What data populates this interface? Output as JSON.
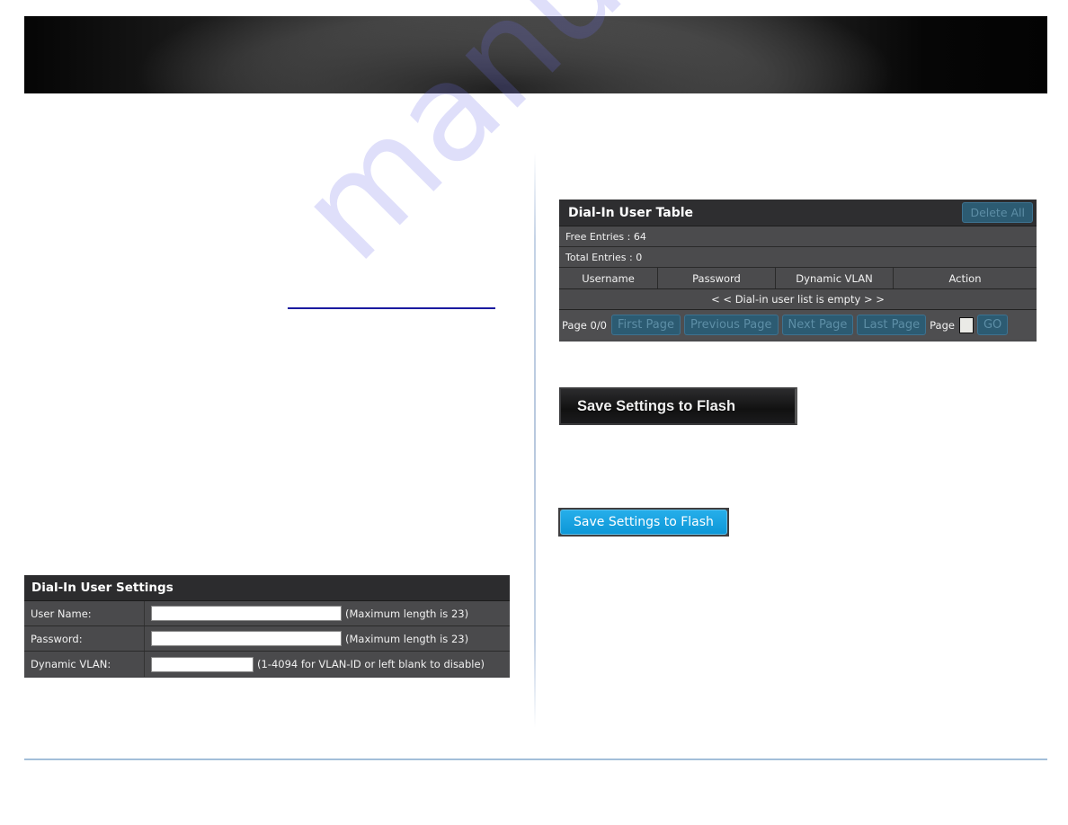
{
  "watermark": "manualshive.com",
  "settings_panel": {
    "title": "Dial-In User Settings",
    "rows": [
      {
        "label": "User Name:",
        "value": "",
        "hint": "(Maximum length is 23)"
      },
      {
        "label": "Password:",
        "value": "",
        "hint": "(Maximum length is 23)"
      },
      {
        "label": "Dynamic VLAN:",
        "value": "",
        "hint": "(1-4094 for VLAN-ID or left blank to disable)"
      }
    ]
  },
  "user_table": {
    "title": "Dial-In User Table",
    "delete_all_label": "Delete All",
    "free_entries": "Free Entries : 64",
    "total_entries": "Total Entries : 0",
    "columns": [
      "Username",
      "Password",
      "Dynamic VLAN",
      "Action"
    ],
    "empty_message": "< < Dial-in user list is empty > >",
    "pager": {
      "page_status": "Page 0/0",
      "first_label": "First Page",
      "previous_label": "Previous Page",
      "next_label": "Next Page",
      "last_label": "Last Page",
      "page_label": "Page",
      "page_value": "",
      "go_label": "GO"
    }
  },
  "save_dark_label": "Save Settings to Flash",
  "save_blue_label": "Save Settings to Flash"
}
